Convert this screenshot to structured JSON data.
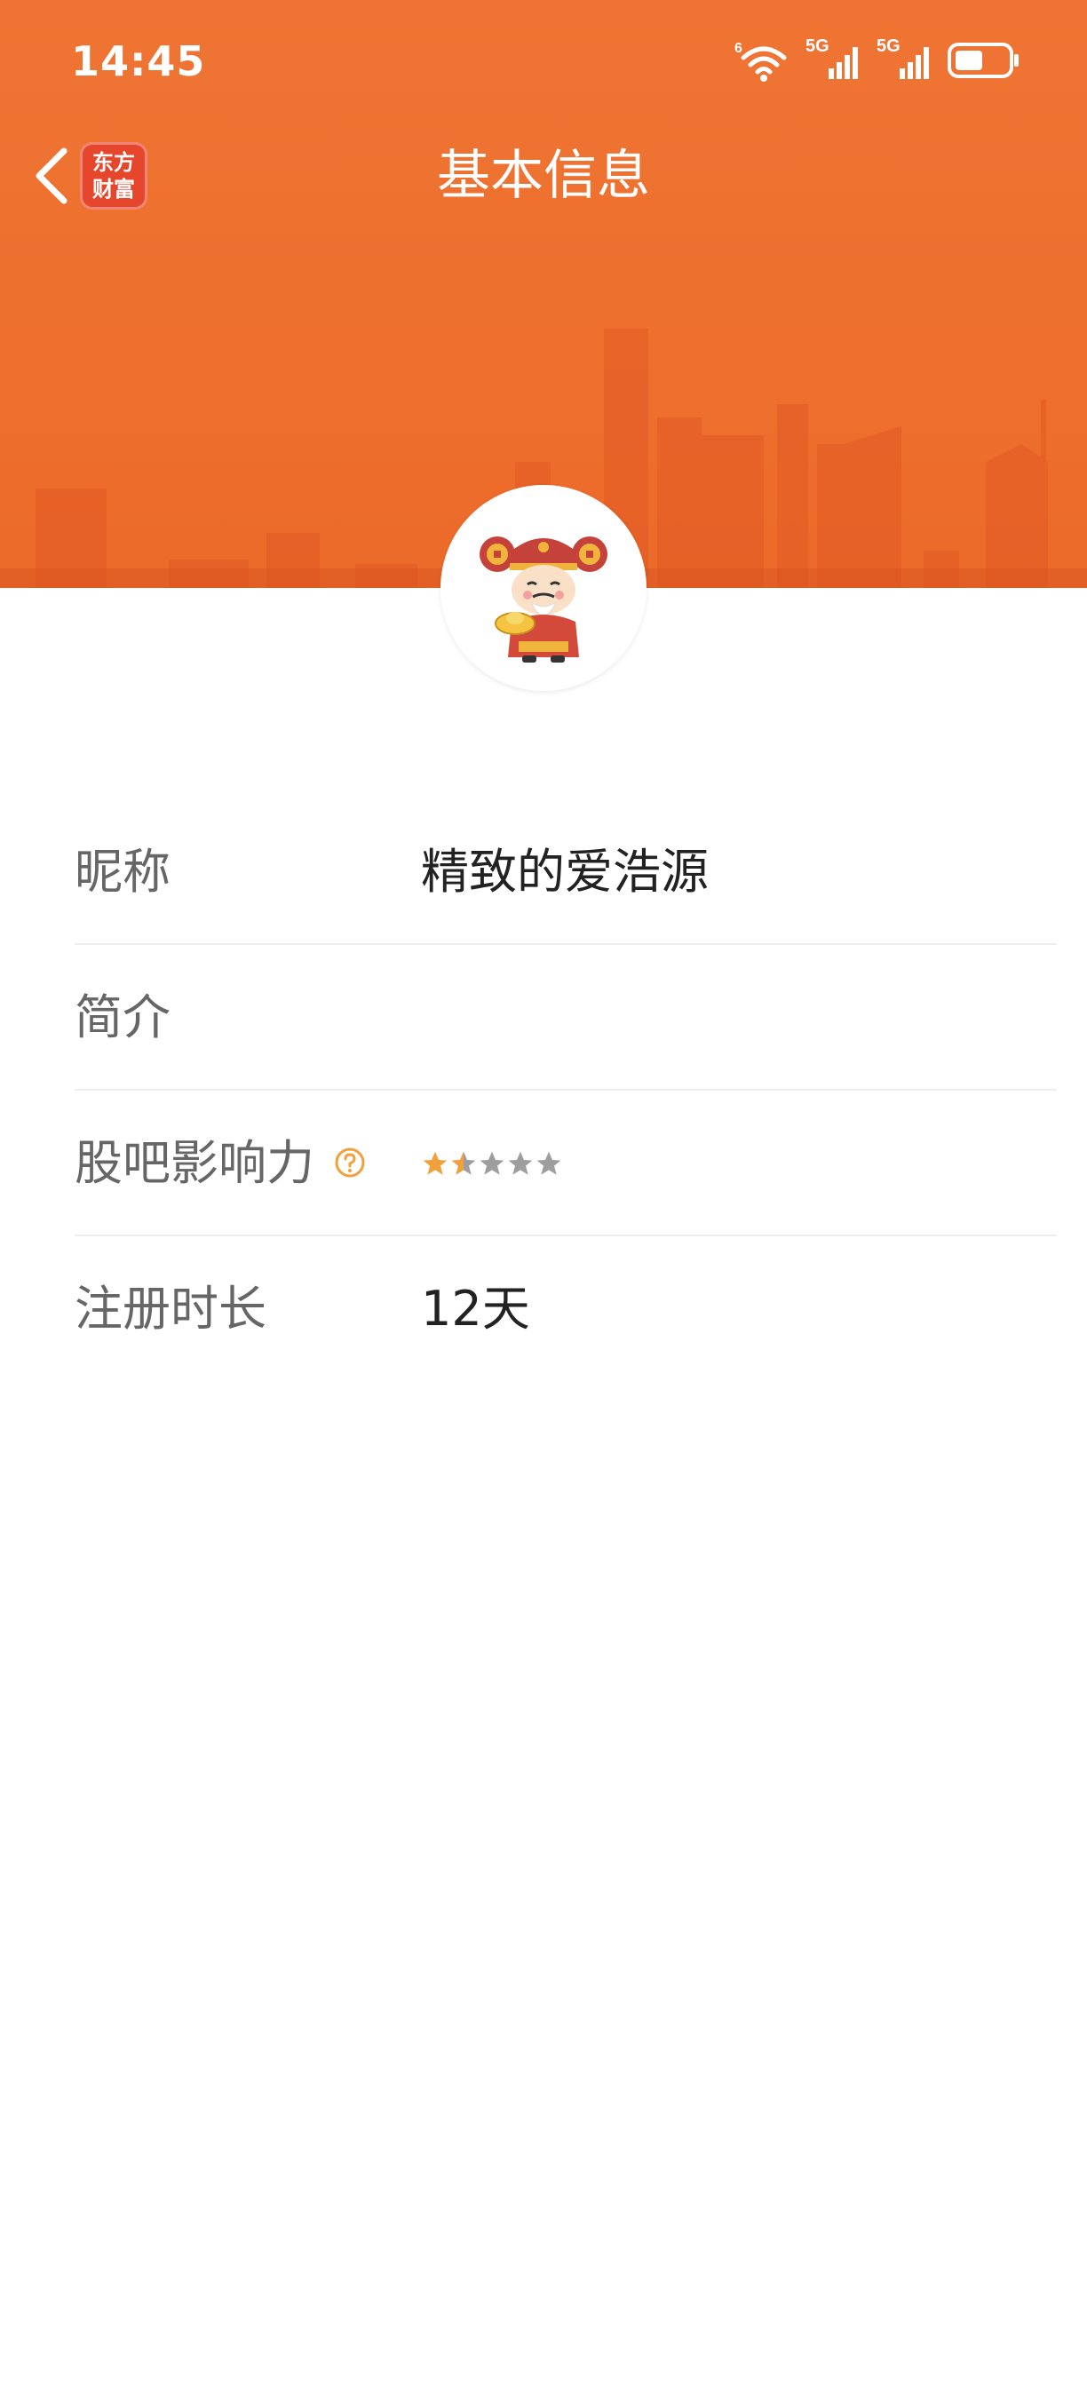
{
  "status_bar": {
    "time": "14:45",
    "network_1": "5G",
    "network_2": "5G",
    "wifi_badge": "6"
  },
  "nav": {
    "title": "基本信息",
    "logo_line1": "东方",
    "logo_line2": "财富"
  },
  "colors": {
    "banner": "#ee7030",
    "star_filled": "#f0a13b",
    "star_empty": "#9e9e9e",
    "help_icon": "#f0a13b"
  },
  "profile": {
    "rows": [
      {
        "label": "昵称",
        "value": "精致的爱浩源"
      },
      {
        "label": "简介",
        "value": ""
      },
      {
        "label": "股吧影响力",
        "value": ""
      },
      {
        "label": "注册时长",
        "value": "12天"
      }
    ],
    "influence_rating": 1.5,
    "influence_max": 5
  },
  "icons": {
    "back": "chevron-left-icon",
    "help": "question-circle-icon",
    "avatar": "caishen-avatar-icon",
    "wifi": "wifi-icon",
    "signal": "signal-icon",
    "battery": "battery-icon"
  }
}
